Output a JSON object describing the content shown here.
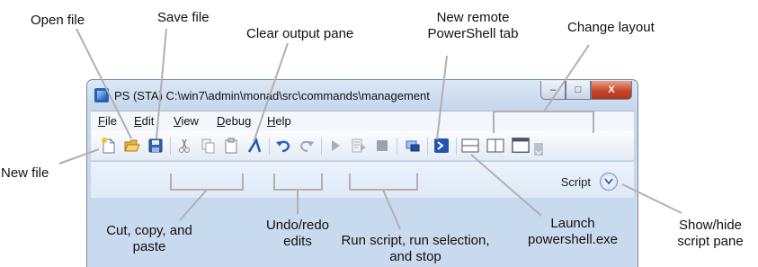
{
  "window": {
    "title": "PS (STA)  C:\\win7\\admin\\monad\\src\\commands\\management",
    "caption_buttons": {
      "minimize": "–",
      "maximize": "□",
      "close": "X"
    }
  },
  "menu": {
    "items": [
      {
        "accel": "F",
        "rest": "ile"
      },
      {
        "accel": "E",
        "rest": "dit"
      },
      {
        "accel": "V",
        "rest": "iew"
      },
      {
        "accel": "D",
        "rest": "ebug"
      },
      {
        "accel": "H",
        "rest": "elp"
      }
    ]
  },
  "toolbar": {
    "icons": [
      "new-file-icon",
      "open-file-icon",
      "save-file-icon",
      "cut-icon",
      "copy-icon",
      "paste-icon",
      "clear-output-icon",
      "undo-icon",
      "redo-icon",
      "run-script-icon",
      "run-selection-icon",
      "stop-icon",
      "new-remote-tab-icon",
      "launch-powershell-icon",
      "layout-top-icon",
      "layout-side-icon",
      "layout-max-icon"
    ]
  },
  "script_pane": {
    "label": "Script"
  },
  "callouts": {
    "open_file": "Open file",
    "save_file": "Save file",
    "clear_output": "Clear output pane",
    "new_remote_line1": "New remote",
    "new_remote_line2": "PowerShell tab",
    "change_layout": "Change layout",
    "new_file": "New file",
    "cut_copy_line1": "Cut, copy, and",
    "cut_copy_line2": "paste",
    "undo_line1": "Undo/redo",
    "undo_line2": "edits",
    "run_line1": "Run script, run selection,",
    "run_line2": "and stop",
    "launch_line1": "Launch",
    "launch_line2": "powershell.exe",
    "showhide_line1": "Show/hide",
    "showhide_line2": "script pane"
  }
}
